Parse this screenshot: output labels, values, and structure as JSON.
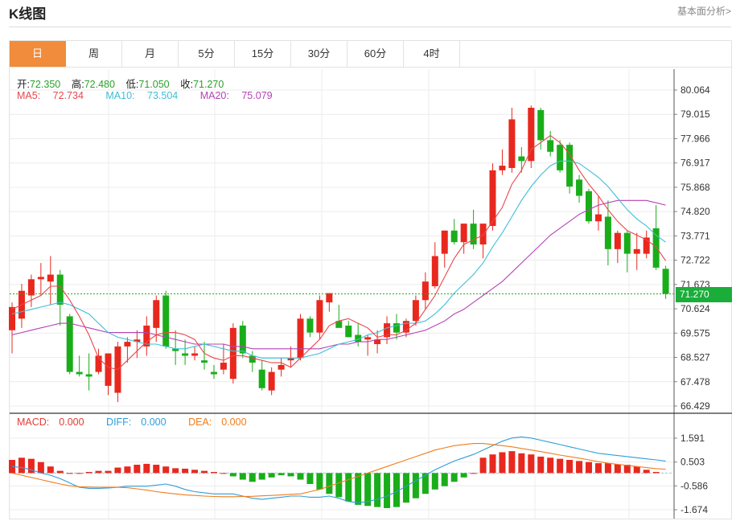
{
  "header": {
    "title": "K线图",
    "more_link": "基本面分析>"
  },
  "tabs": [
    "日",
    "周",
    "月",
    "5分",
    "15分",
    "30分",
    "60分",
    "4时"
  ],
  "active_tab": "日",
  "legend": {
    "ohlc": [
      {
        "label": "开:",
        "value": "72.350"
      },
      {
        "label": "高:",
        "value": "72.480"
      },
      {
        "label": "低:",
        "value": "71.050"
      },
      {
        "label": "收:",
        "value": "71.270"
      }
    ],
    "ma": [
      {
        "label": "MA5:",
        "value": "72.734"
      },
      {
        "label": "MA10:",
        "value": "73.504"
      },
      {
        "label": "MA20:",
        "value": "75.079"
      }
    ],
    "macd": [
      {
        "label": "MACD:",
        "value": "0.000"
      },
      {
        "label": "DIFF:",
        "value": "0.000"
      },
      {
        "label": "DEA:",
        "value": "0.000"
      }
    ]
  },
  "current_price": "71.270",
  "colors": {
    "up": "#e8281e",
    "down": "#1aad1a",
    "ma5": "#e8474d",
    "ma10": "#3dbfd6",
    "ma20": "#b443b4",
    "diff": "#2f9ed9",
    "dea": "#f07d1d",
    "accent": "#f08c3b"
  },
  "chart_data": [
    {
      "type": "candlestick",
      "y_ticks": [
        "80.064",
        "79.015",
        "77.966",
        "76.917",
        "75.868",
        "74.820",
        "73.771",
        "72.722",
        "71.673",
        "70.624",
        "69.575",
        "68.527",
        "67.478",
        "66.429"
      ],
      "ylim": [
        66.429,
        80.064
      ],
      "current_price": 71.27,
      "ohlc": [
        [
          69.7,
          70.9,
          68.7,
          70.7
        ],
        [
          70.2,
          71.7,
          69.8,
          71.4
        ],
        [
          71.2,
          72.1,
          70.7,
          71.9
        ],
        [
          71.9,
          72.6,
          71.2,
          72.0
        ],
        [
          71.8,
          72.9,
          70.8,
          72.1
        ],
        [
          72.1,
          72.3,
          69.9,
          70.8
        ],
        [
          70.3,
          70.4,
          67.8,
          67.9
        ],
        [
          67.9,
          68.6,
          67.7,
          67.8
        ],
        [
          67.8,
          68.7,
          67.1,
          67.7
        ],
        [
          67.9,
          68.9,
          67.8,
          68.6
        ],
        [
          67.3,
          68.7,
          66.9,
          68.7
        ],
        [
          67.0,
          69.2,
          66.6,
          69.0
        ],
        [
          69.0,
          69.4,
          68.3,
          69.2
        ],
        [
          69.2,
          69.7,
          68.5,
          69.3
        ],
        [
          69.0,
          70.3,
          68.6,
          69.9
        ],
        [
          69.8,
          71.2,
          69.2,
          71.0
        ],
        [
          71.2,
          71.4,
          68.9,
          69.0
        ],
        [
          68.9,
          69.7,
          68.2,
          68.8
        ],
        [
          68.7,
          69.3,
          68.2,
          68.6
        ],
        [
          68.6,
          69.0,
          68.4,
          68.7
        ],
        [
          68.4,
          69.2,
          68.0,
          68.3
        ],
        [
          67.9,
          68.2,
          67.6,
          67.8
        ],
        [
          68.0,
          69.1,
          67.8,
          68.3
        ],
        [
          67.6,
          70.0,
          67.4,
          69.8
        ],
        [
          69.9,
          70.1,
          68.5,
          68.7
        ],
        [
          68.6,
          68.8,
          67.9,
          68.3
        ],
        [
          68.0,
          68.4,
          67.1,
          67.2
        ],
        [
          67.1,
          68.1,
          66.9,
          67.9
        ],
        [
          68.0,
          68.5,
          67.7,
          68.2
        ],
        [
          68.4,
          69.0,
          68.1,
          68.5
        ],
        [
          68.5,
          70.4,
          68.4,
          70.2
        ],
        [
          70.2,
          70.3,
          69.4,
          69.6
        ],
        [
          69.6,
          71.2,
          69.3,
          71.0
        ],
        [
          70.9,
          71.3,
          70.5,
          71.3
        ],
        [
          70.1,
          70.8,
          69.9,
          69.8
        ],
        [
          69.9,
          70.1,
          69.4,
          69.4
        ],
        [
          69.5,
          70.0,
          69.0,
          69.2
        ],
        [
          69.3,
          69.5,
          68.6,
          69.4
        ],
        [
          69.1,
          69.7,
          68.7,
          69.3
        ],
        [
          69.4,
          70.3,
          69.1,
          70.0
        ],
        [
          70.0,
          70.4,
          69.3,
          69.6
        ],
        [
          69.6,
          70.2,
          69.4,
          70.1
        ],
        [
          70.1,
          71.2,
          69.9,
          71.0
        ],
        [
          71.0,
          72.2,
          70.6,
          71.8
        ],
        [
          71.6,
          73.5,
          71.5,
          72.9
        ],
        [
          73.0,
          74.0,
          72.4,
          74.0
        ],
        [
          74.0,
          74.5,
          73.4,
          73.5
        ],
        [
          73.5,
          74.3,
          73.0,
          74.3
        ],
        [
          74.3,
          74.9,
          73.2,
          73.4
        ],
        [
          73.4,
          74.2,
          72.8,
          74.3
        ],
        [
          74.2,
          76.9,
          74.0,
          76.6
        ],
        [
          76.6,
          77.5,
          76.4,
          76.8
        ],
        [
          76.7,
          79.3,
          76.5,
          78.8
        ],
        [
          77.2,
          77.6,
          76.5,
          77.0
        ],
        [
          77.0,
          79.4,
          76.7,
          79.3
        ],
        [
          79.2,
          79.3,
          77.5,
          77.9
        ],
        [
          77.9,
          78.3,
          77.2,
          77.4
        ],
        [
          77.7,
          77.9,
          76.5,
          76.6
        ],
        [
          77.7,
          77.8,
          75.6,
          75.9
        ],
        [
          76.2,
          76.4,
          75.2,
          75.5
        ],
        [
          75.7,
          75.8,
          74.3,
          74.4
        ],
        [
          74.4,
          75.5,
          74.0,
          74.7
        ],
        [
          74.6,
          75.3,
          72.5,
          73.2
        ],
        [
          73.2,
          74.0,
          72.6,
          73.9
        ],
        [
          73.9,
          74.0,
          72.2,
          73.0
        ],
        [
          73.0,
          73.9,
          72.3,
          73.2
        ],
        [
          73.0,
          74.0,
          72.8,
          73.7
        ],
        [
          74.1,
          75.1,
          72.3,
          72.4
        ],
        [
          72.35,
          72.48,
          71.05,
          71.27
        ]
      ],
      "ma5": [
        70.6,
        70.8,
        71.0,
        71.2,
        71.6,
        71.6,
        71.0,
        70.3,
        69.5,
        68.5,
        68.1,
        68.0,
        68.4,
        68.8,
        69.2,
        69.5,
        69.6,
        69.6,
        69.5,
        69.3,
        68.7,
        68.5,
        68.4,
        68.6,
        68.6,
        68.5,
        68.4,
        68.3,
        68.3,
        68.1,
        68.5,
        68.9,
        69.3,
        69.9,
        70.1,
        70.2,
        70.0,
        69.8,
        69.4,
        69.5,
        69.5,
        69.7,
        70.0,
        70.6,
        71.2,
        72.0,
        72.8,
        73.4,
        73.6,
        73.8,
        74.4,
        75.0,
        76.0,
        76.6,
        77.5,
        77.8,
        78.1,
        77.8,
        77.3,
        76.6,
        76.0,
        75.5,
        74.9,
        74.4,
        74.0,
        73.8,
        73.6,
        73.3,
        72.7
      ],
      "ma10": [
        70.4,
        70.5,
        70.6,
        70.7,
        70.8,
        70.9,
        70.8,
        70.6,
        70.4,
        70.0,
        69.6,
        69.4,
        69.3,
        69.2,
        69.1,
        69.1,
        69.0,
        68.9,
        68.9,
        69.0,
        69.1,
        69.0,
        68.9,
        68.8,
        68.8,
        68.6,
        68.5,
        68.5,
        68.5,
        68.5,
        68.5,
        68.6,
        68.7,
        68.9,
        69.1,
        69.2,
        69.3,
        69.5,
        69.6,
        69.8,
        69.9,
        70.0,
        70.0,
        70.1,
        70.4,
        70.8,
        71.3,
        71.7,
        72.1,
        72.6,
        73.3,
        73.9,
        74.6,
        75.3,
        75.9,
        76.4,
        76.8,
        77.0,
        77.0,
        76.9,
        76.6,
        76.3,
        75.9,
        75.4,
        74.9,
        74.5,
        74.2,
        73.8,
        73.5
      ],
      "ma20": [
        69.5,
        69.6,
        69.7,
        69.8,
        69.9,
        70.0,
        70.0,
        69.9,
        69.8,
        69.7,
        69.6,
        69.6,
        69.6,
        69.6,
        69.6,
        69.5,
        69.4,
        69.3,
        69.2,
        69.1,
        69.1,
        69.1,
        69.1,
        69.0,
        69.0,
        68.9,
        68.9,
        68.9,
        68.9,
        68.9,
        68.9,
        68.9,
        68.9,
        69.0,
        69.1,
        69.1,
        69.2,
        69.2,
        69.3,
        69.3,
        69.4,
        69.5,
        69.6,
        69.7,
        69.9,
        70.1,
        70.4,
        70.6,
        70.9,
        71.2,
        71.5,
        71.8,
        72.2,
        72.6,
        73.0,
        73.4,
        73.8,
        74.1,
        74.4,
        74.7,
        74.9,
        75.1,
        75.2,
        75.3,
        75.3,
        75.3,
        75.3,
        75.2,
        75.1
      ]
    },
    {
      "type": "macd",
      "y_ticks": [
        "1.591",
        "0.503",
        "-0.586",
        "-1.674"
      ],
      "ylim": [
        -1.674,
        1.591
      ],
      "hist": [
        0.6,
        0.7,
        0.65,
        0.5,
        0.3,
        0.1,
        0.0,
        0.0,
        0.05,
        0.1,
        0.1,
        0.25,
        0.3,
        0.38,
        0.42,
        0.38,
        0.3,
        0.22,
        0.2,
        0.15,
        0.1,
        0.05,
        0.0,
        -0.15,
        -0.3,
        -0.4,
        -0.3,
        -0.2,
        -0.1,
        -0.15,
        -0.3,
        -0.5,
        -0.75,
        -0.95,
        -1.1,
        -1.3,
        -1.45,
        -1.5,
        -1.55,
        -1.6,
        -1.55,
        -1.35,
        -1.15,
        -0.95,
        -0.75,
        -0.6,
        -0.4,
        -0.2,
        0.0,
        0.7,
        0.85,
        0.95,
        1.0,
        0.9,
        0.85,
        0.75,
        0.7,
        0.65,
        0.6,
        0.55,
        0.5,
        0.45,
        0.45,
        0.4,
        0.38,
        0.3,
        0.15,
        0.05
      ],
      "diff": [
        0.3,
        0.25,
        0.15,
        0.0,
        -0.1,
        -0.25,
        -0.45,
        -0.65,
        -0.7,
        -0.7,
        -0.68,
        -0.65,
        -0.6,
        -0.6,
        -0.6,
        -0.55,
        -0.5,
        -0.6,
        -0.75,
        -0.85,
        -0.9,
        -0.95,
        -0.95,
        -0.95,
        -1.05,
        -1.15,
        -1.2,
        -1.15,
        -1.1,
        -1.05,
        -1.05,
        -1.1,
        -1.1,
        -1.05,
        -1.15,
        -1.3,
        -1.35,
        -1.3,
        -1.2,
        -1.05,
        -0.85,
        -0.6,
        -0.35,
        -0.1,
        0.15,
        0.35,
        0.55,
        0.7,
        0.85,
        1.05,
        1.25,
        1.45,
        1.6,
        1.65,
        1.6,
        1.5,
        1.4,
        1.3,
        1.2,
        1.1,
        1.0,
        0.9,
        0.85,
        0.8,
        0.75,
        0.7,
        0.65,
        0.6,
        0.55
      ],
      "dea": [
        0.0,
        -0.1,
        -0.2,
        -0.3,
        -0.4,
        -0.5,
        -0.58,
        -0.63,
        -0.64,
        -0.65,
        -0.65,
        -0.65,
        -0.67,
        -0.72,
        -0.78,
        -0.85,
        -0.9,
        -0.95,
        -1.0,
        -1.02,
        -1.05,
        -1.07,
        -1.08,
        -1.08,
        -1.07,
        -1.06,
        -1.04,
        -1.02,
        -1.0,
        -0.97,
        -0.95,
        -0.85,
        -0.75,
        -0.6,
        -0.45,
        -0.3,
        -0.15,
        0.0,
        0.15,
        0.3,
        0.45,
        0.6,
        0.75,
        0.9,
        1.05,
        1.15,
        1.25,
        1.3,
        1.35,
        1.35,
        1.3,
        1.25,
        1.2,
        1.12,
        1.05,
        0.98,
        0.9,
        0.82,
        0.75,
        0.68,
        0.6,
        0.52,
        0.45,
        0.4,
        0.35,
        0.3,
        0.25,
        0.2,
        0.18
      ]
    }
  ]
}
